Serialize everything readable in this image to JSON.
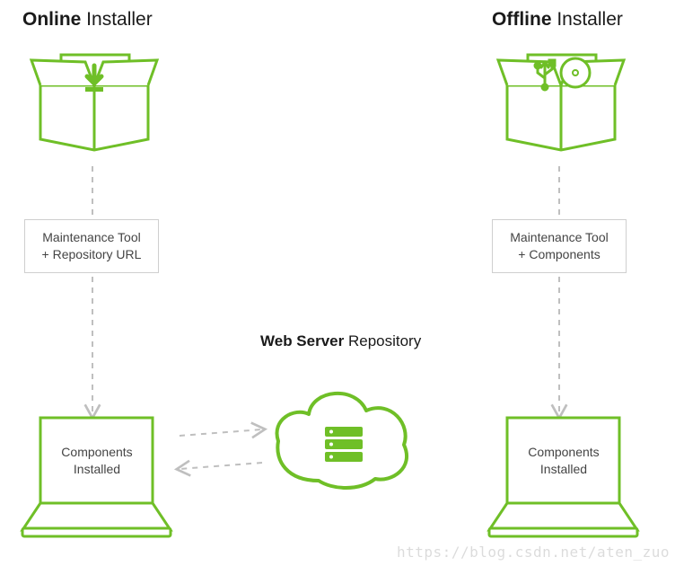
{
  "headings": {
    "online_bold": "Online",
    "online_light": " Installer",
    "offline_bold": "Offline",
    "offline_light": " Installer"
  },
  "boxes": {
    "maintenance_url_l1": "Maintenance Tool",
    "maintenance_url_l2": "+ Repository URL",
    "maintenance_comp_l1": "Maintenance Tool",
    "maintenance_comp_l2": "+ Components"
  },
  "repo": {
    "bold": "Web Server",
    "light": " Repository"
  },
  "laptop": {
    "line1": "Components",
    "line2": "Installed"
  },
  "watermark": "https://blog.csdn.net/aten_zuo",
  "colors": {
    "green": "#6fbf27",
    "green_dk": "#4f9e1a",
    "grey": "#bfbfbf"
  }
}
